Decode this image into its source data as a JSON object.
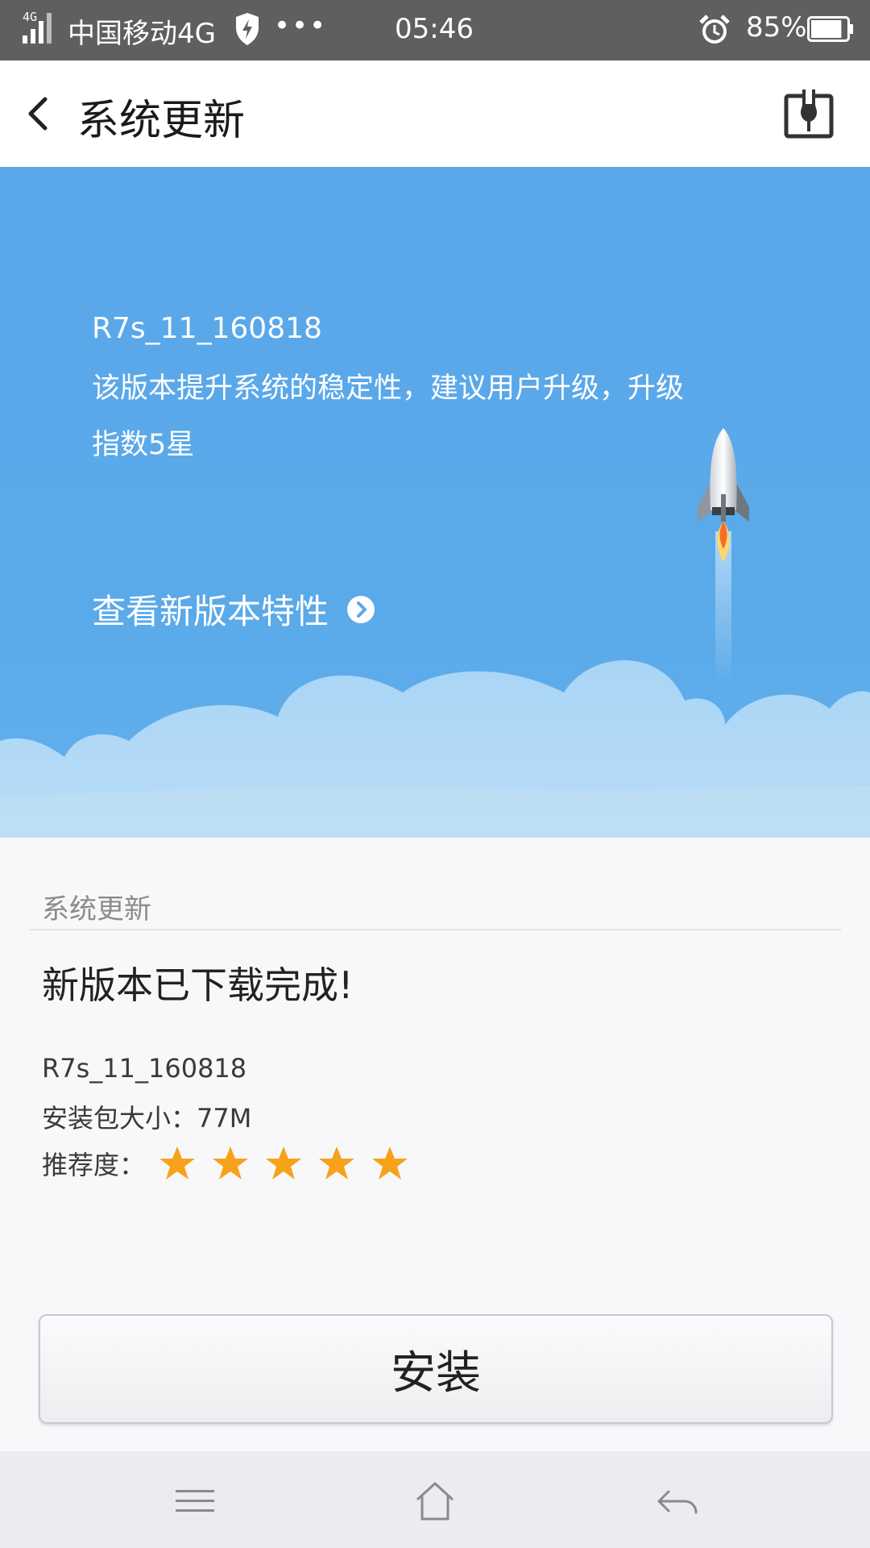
{
  "status_bar": {
    "network_small": "4G",
    "carrier": "中国移动4G",
    "more": "•••",
    "time": "05:46",
    "battery": "85%",
    "battery_level": 0.85
  },
  "header": {
    "title": "系统更新"
  },
  "hero": {
    "version": "R7s_11_160818",
    "description": "该版本提升系统的稳定性，建议用户升级，升级指数5星",
    "link_label": "查看新版本特性"
  },
  "update_card": {
    "section_label": "系统更新",
    "status_message": "新版本已下载完成!",
    "version": "R7s_11_160818",
    "size_text": "安装包大小：77M",
    "rating_label": "推荐度：",
    "rating_value": 5,
    "rating_max": 5
  },
  "actions": {
    "install_label": "安装"
  },
  "colors": {
    "status_bar": "#5f5f5f",
    "hero_blue": "#5aa8ea",
    "star": "#f7a21b"
  },
  "icons": [
    "signal-icon",
    "shield-icon",
    "alarm-icon",
    "battery-icon",
    "back-arrow-icon",
    "update-tool-icon",
    "chevron-right-icon",
    "rocket-icon",
    "star-icon",
    "menu-icon",
    "home-icon",
    "back-icon"
  ]
}
